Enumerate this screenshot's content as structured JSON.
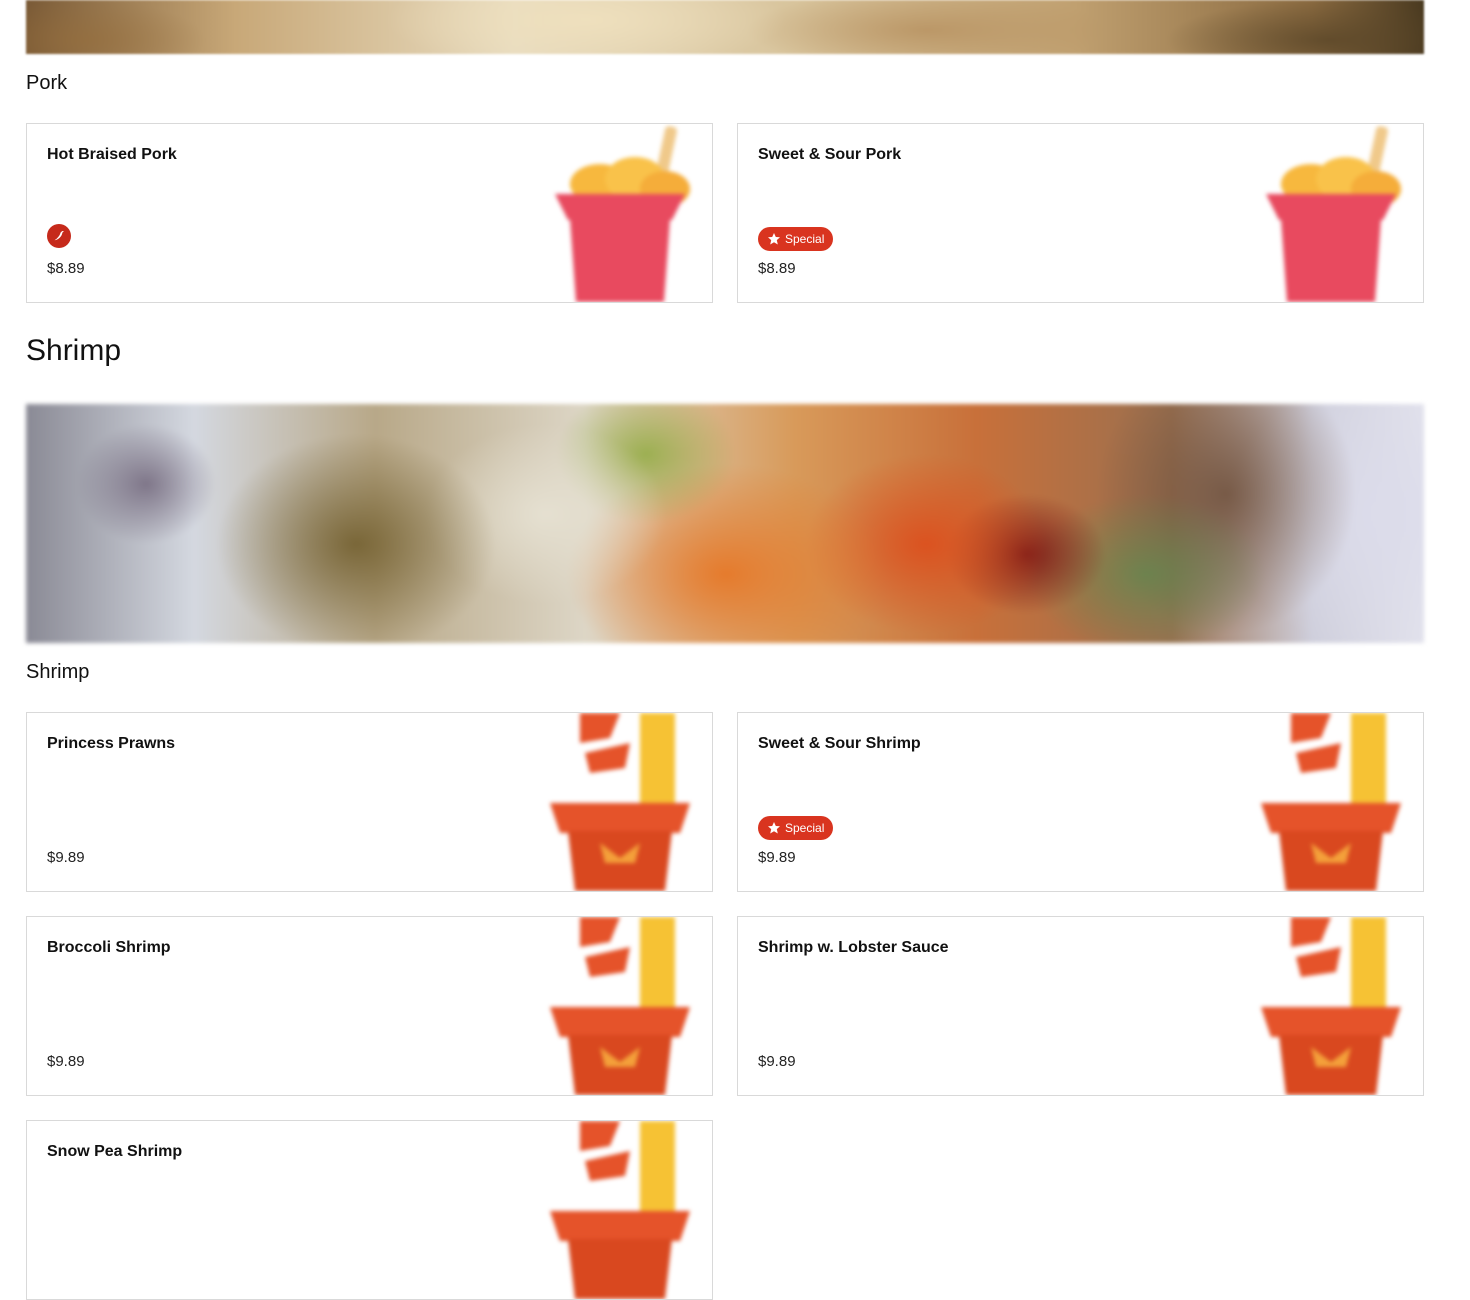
{
  "categories": [
    {
      "title": "Pork",
      "items": [
        {
          "name": "Hot Braised Pork",
          "price": "$8.89",
          "badge": "spicy",
          "badge_icon": "chili-pepper-icon"
        },
        {
          "name": "Sweet & Sour Pork",
          "price": "$8.89",
          "badge": "special",
          "badge_label": "Special",
          "badge_icon": "star-icon"
        }
      ]
    },
    {
      "title": "Shrimp",
      "subtitle": "Shrimp",
      "items": [
        {
          "name": "Princess Prawns",
          "price": "$9.89"
        },
        {
          "name": "Sweet & Sour Shrimp",
          "price": "$9.89",
          "badge": "special",
          "badge_label": "Special",
          "badge_icon": "star-icon"
        },
        {
          "name": "Broccoli Shrimp",
          "price": "$9.89"
        },
        {
          "name": "Shrimp w. Lobster Sauce",
          "price": "$9.89"
        },
        {
          "name": "Snow Pea Shrimp",
          "price": ""
        }
      ]
    }
  ],
  "colors": {
    "special_badge": "#d9341f",
    "spicy_badge": "#c62a1b",
    "pork_box": "#e84a5f",
    "shrimp_box": "#e5532a",
    "card_border": "#d9d9d9"
  }
}
